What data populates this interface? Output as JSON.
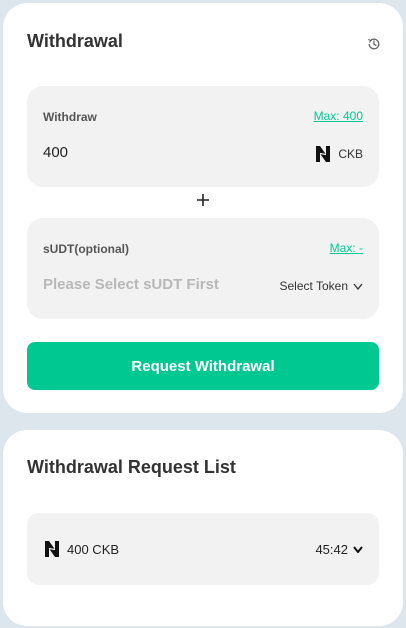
{
  "withdraw_card": {
    "title": "Withdrawal",
    "history_icon": "history-clock-icon",
    "withdraw_panel": {
      "label": "Withdraw",
      "max_label": "Max: 400",
      "amount_value": "400",
      "token_icon": "nervos-logo-icon",
      "token_symbol": "CKB"
    },
    "plus_icon": "plus-icon",
    "sudt_panel": {
      "label": "sUDT(optional)",
      "max_label": "Max: -",
      "placeholder": "Please Select sUDT First",
      "select_label": "Select Token",
      "select_icon": "chevron-down-icon"
    },
    "submit_label": "Request Withdrawal"
  },
  "request_list": {
    "title": "Withdrawal Request List",
    "items": [
      {
        "token_icon": "nervos-logo-icon",
        "amount": "400 CKB",
        "time": "45:42",
        "expand_icon": "chevron-down-icon"
      }
    ]
  },
  "colors": {
    "accent": "#00c891",
    "page_background": "#dce6ec",
    "card_background": "#ffffff",
    "panel_background": "#f2f2f2",
    "title_text": "#333333",
    "placeholder_text": "#b8b8b8"
  }
}
